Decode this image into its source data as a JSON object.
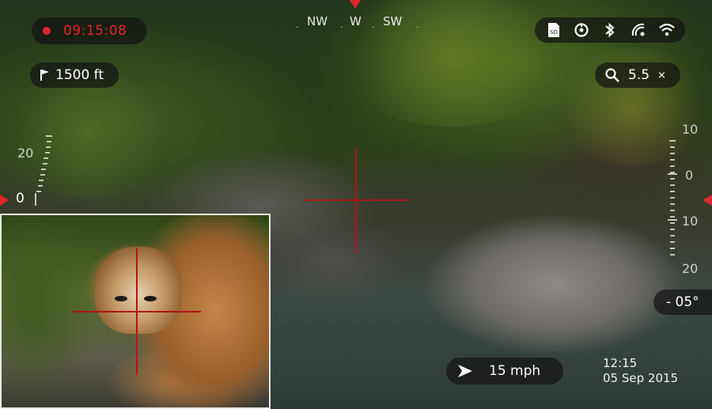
{
  "recording": {
    "time": "09:15:08"
  },
  "range": {
    "value": "1500 ft"
  },
  "compass": {
    "headings": [
      "NW",
      "W",
      "SW"
    ],
    "active": "W"
  },
  "status_icons": [
    "sd-card-icon",
    "timer-icon",
    "bluetooth-icon",
    "gps-icon",
    "wifi-icon"
  ],
  "zoom": {
    "value": "5.5",
    "unit": "×"
  },
  "left_scale": {
    "label_top": "20",
    "label_mid": "0"
  },
  "right_scale": {
    "labels": [
      "10",
      "0",
      "10",
      "20"
    ]
  },
  "incline": {
    "value": "- 05°"
  },
  "wind": {
    "value": "15 mph"
  },
  "clock": {
    "time": "12:15",
    "date": "05 Sep 2015"
  },
  "colors": {
    "accent": "#e0262a",
    "reticle": "#b01515",
    "pill_bg": "rgba(20,20,20,0.72)"
  }
}
